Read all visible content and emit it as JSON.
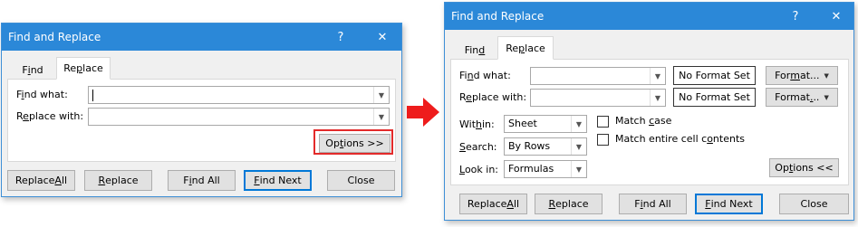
{
  "left_dialog": {
    "title": "Find and Replace",
    "help": "?",
    "close": "✕",
    "tabs": [
      {
        "prefix": "F",
        "underline": "i",
        "suffix": "nd"
      },
      {
        "prefix": "Re",
        "underline": "p",
        "suffix": "lace"
      }
    ],
    "find_label": {
      "prefix": "F",
      "underline": "i",
      "suffix": "nd what:"
    },
    "replace_label": {
      "prefix": "R",
      "underline": "e",
      "suffix": "place with:"
    },
    "find_value": "",
    "replace_value": "",
    "options_button": {
      "prefix": "Op",
      "underline": "t",
      "suffix": "ions >>"
    },
    "buttons": {
      "replace_all": {
        "prefix": "Replace ",
        "underline": "A",
        "suffix": "ll"
      },
      "replace": {
        "prefix": "",
        "underline": "R",
        "suffix": "eplace"
      },
      "find_all": {
        "prefix": "F",
        "underline": "i",
        "suffix": "nd All"
      },
      "find_next": {
        "prefix": "",
        "underline": "F",
        "suffix": "ind Next"
      },
      "close": "Close"
    }
  },
  "right_dialog": {
    "title": "Find and Replace",
    "help": "?",
    "close": "✕",
    "tabs": [
      {
        "prefix": "Fin",
        "underline": "d",
        "suffix": ""
      },
      {
        "prefix": "Re",
        "underline": "p",
        "suffix": "lace"
      }
    ],
    "find_label": {
      "prefix": "Fi",
      "underline": "n",
      "suffix": "d what:"
    },
    "replace_label": {
      "prefix": "R",
      "underline": "e",
      "suffix": "place with:"
    },
    "no_format_1": "No Format Set",
    "no_format_2": "No Format Set",
    "format_1": {
      "prefix": "For",
      "underline": "m",
      "suffix": "at..."
    },
    "format_2": {
      "prefix": "Format",
      "underline": ".",
      "suffix": ".."
    },
    "within_label": {
      "prefix": "Wit",
      "underline": "h",
      "suffix": "in:"
    },
    "within_value": "Sheet",
    "search_label": {
      "prefix": "",
      "underline": "S",
      "suffix": "earch:"
    },
    "search_value": "By Rows",
    "lookin_label": {
      "prefix": "",
      "underline": "L",
      "suffix": "ook in:"
    },
    "lookin_value": "Formulas",
    "match_case": {
      "prefix": "Match ",
      "underline": "c",
      "suffix": "ase"
    },
    "match_entire": {
      "prefix": "Match entire cell c",
      "underline": "o",
      "suffix": "ntents"
    },
    "options_button": {
      "prefix": "Op",
      "underline": "t",
      "suffix": "ions <<"
    },
    "buttons": {
      "replace_all": {
        "prefix": "Replace ",
        "underline": "A",
        "suffix": "ll"
      },
      "replace": {
        "prefix": "",
        "underline": "R",
        "suffix": "eplace"
      },
      "find_all": {
        "prefix": "F",
        "underline": "i",
        "suffix": "nd All"
      },
      "find_next": {
        "prefix": "",
        "underline": "F",
        "suffix": "ind Next"
      },
      "close": "Close"
    }
  },
  "colors": {
    "titlebar": "#2b88d8",
    "highlight": "#e32a2a",
    "arrow": "#ee1c1c",
    "default_button": "#0078d7"
  },
  "icons": {
    "dropdown": "chevron-down-icon",
    "arrow": "right-arrow-icon"
  }
}
